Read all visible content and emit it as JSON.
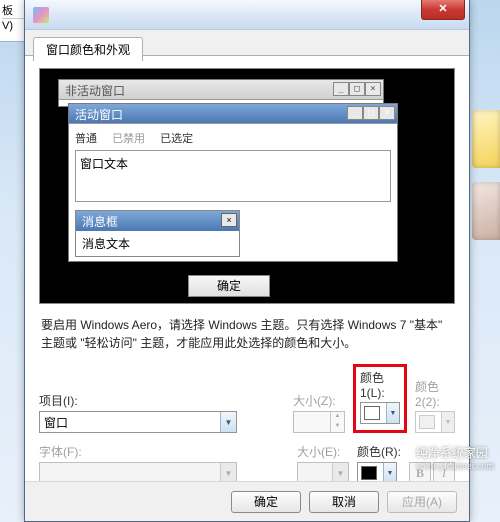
{
  "left_tabs": {
    "top": "板",
    "bottom": "V)"
  },
  "dialog": {
    "tab_label": "窗口颜色和外观",
    "preview": {
      "inactive_title": "非活动窗口",
      "active_title": "活动窗口",
      "menu_normal": "普通",
      "menu_disabled": "已禁用",
      "menu_selected": "已选定",
      "window_text": "窗口文本",
      "msgbox_title": "消息框",
      "msgbox_text": "消息文本",
      "ok_button": "确定"
    },
    "info_text": "要启用 Windows Aero，请选择 Windows 主题。只有选择 Windows 7 \"基本\" 主题或 \"轻松访问\" 主题，才能应用此处选择的颜色和大小。",
    "item_label": "项目(I):",
    "item_value": "窗口",
    "size_label": "大小(Z):",
    "color1_label_line1": "颜色",
    "color1_label_line2": "1(L):",
    "color2_label_line1": "颜色",
    "color2_label_line2": "2(2):",
    "font_label": "字体(F):",
    "fontsize_label": "大小(E):",
    "fontcolor_label": "颜色(R):",
    "bold_label": "B",
    "italic_label": "I",
    "buttons": {
      "ok": "确定",
      "cancel": "取消",
      "apply": "应用(A)"
    }
  },
  "watermark": {
    "line1": "纯净系统家园",
    "line2": "www.yidaimei.com"
  },
  "colors": {
    "swatch_white": "#ffffff",
    "swatch_black": "#000000"
  }
}
